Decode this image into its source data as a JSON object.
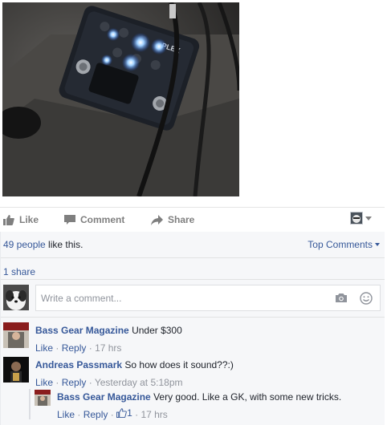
{
  "post": {
    "photo_icon": "guitar-pedal-photo"
  },
  "actions": {
    "like_label": "Like",
    "comment_label": "Comment",
    "share_label": "Share"
  },
  "reactions": {
    "count_text": "49 people",
    "suffix_text": " like this.",
    "sort_label": "Top Comments",
    "shares_text": "1 share"
  },
  "composer": {
    "placeholder": "Write a comment..."
  },
  "comments": [
    {
      "author": "Bass Gear Magazine",
      "text": "Under $300",
      "like_label": "Like",
      "reply_label": "Reply",
      "time": "17 hrs"
    },
    {
      "author": "Andreas Passmark",
      "text": "So how does it sound??:)",
      "like_label": "Like",
      "reply_label": "Reply",
      "time": "Yesterday at 5:18pm"
    }
  ],
  "reply": {
    "author": "Bass Gear Magazine",
    "text": "Very good. Like a GK, with some new tricks.",
    "like_label": "Like",
    "reply_label": "Reply",
    "likes": "1",
    "time": "17 hrs"
  },
  "colors": {
    "link": "#365899",
    "muted": "#90949c",
    "action_gray": "#7f7f7f",
    "ufi_bg": "#f6f7f9"
  }
}
